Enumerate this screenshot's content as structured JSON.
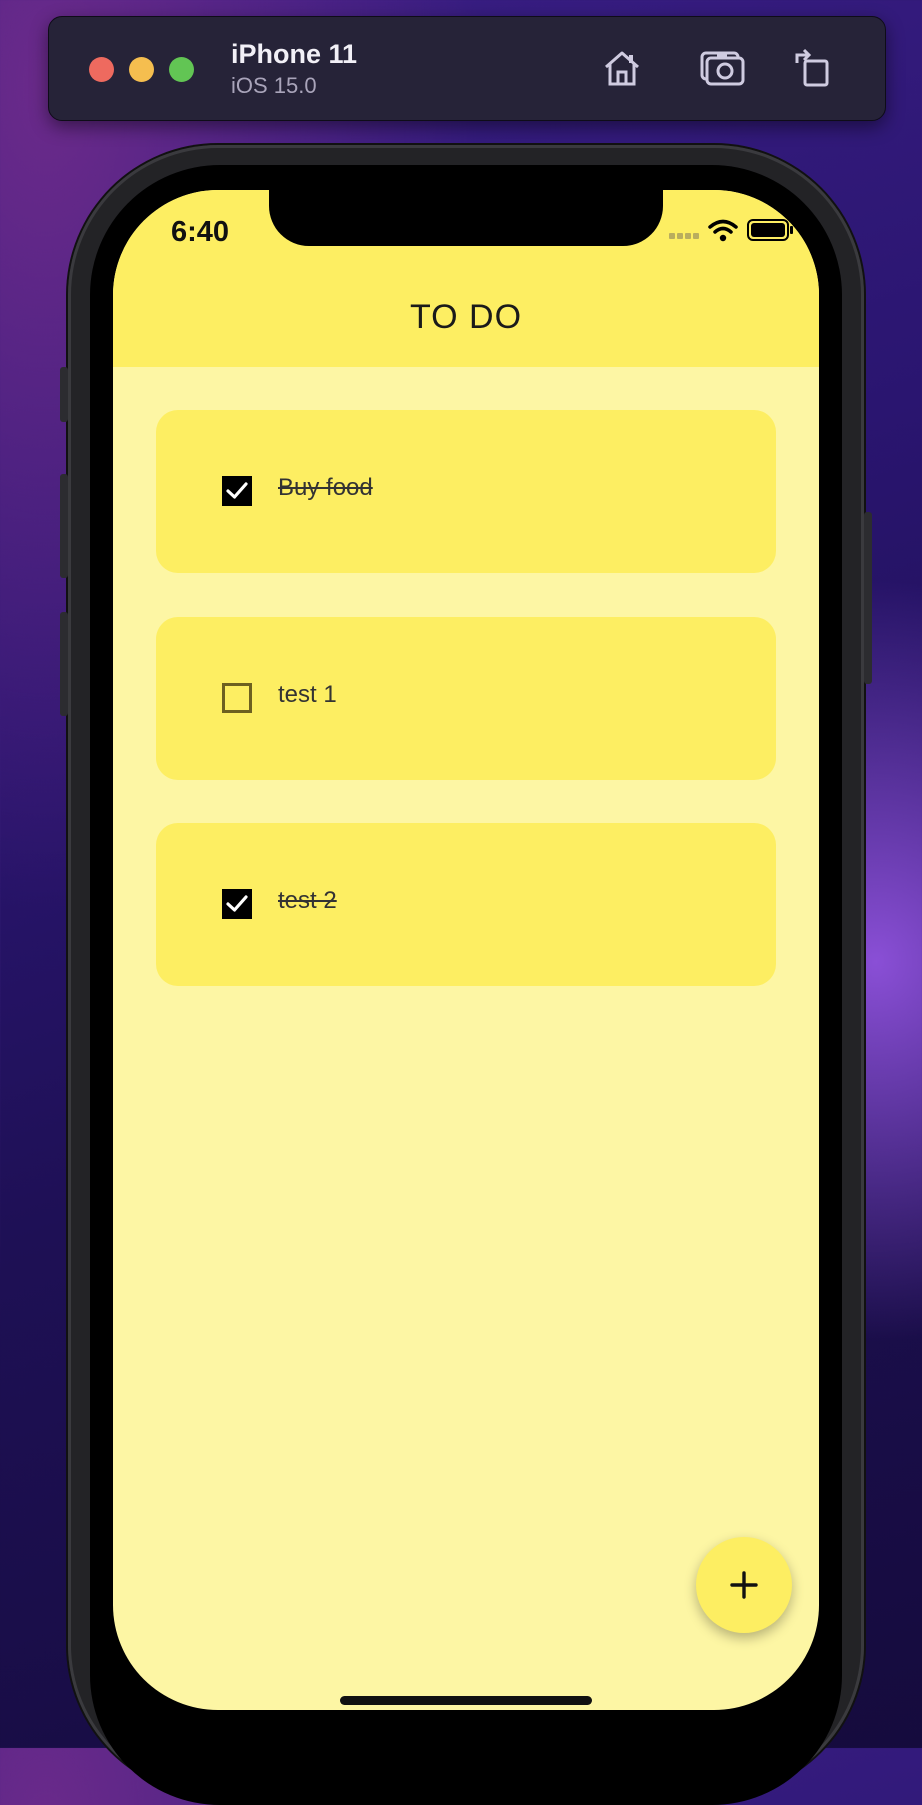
{
  "simulator": {
    "device_name": "iPhone 11",
    "os_version": "iOS 15.0",
    "toolbar_icons": [
      "home-icon",
      "screenshot-camera-icon",
      "rotate-icon"
    ]
  },
  "status_bar": {
    "time": "6:40",
    "icons": [
      "cellular-signal-icon",
      "wifi-icon",
      "battery-icon"
    ]
  },
  "app": {
    "title": "TO DO",
    "colors": {
      "appbar": "#fdee62",
      "background": "#fdf6a4",
      "card": "#fdee62"
    },
    "todos": [
      {
        "label": "Buy food",
        "checked": true
      },
      {
        "label": "test 1",
        "checked": false
      },
      {
        "label": "test 2",
        "checked": true
      }
    ],
    "fab": {
      "icon": "plus-icon"
    }
  }
}
